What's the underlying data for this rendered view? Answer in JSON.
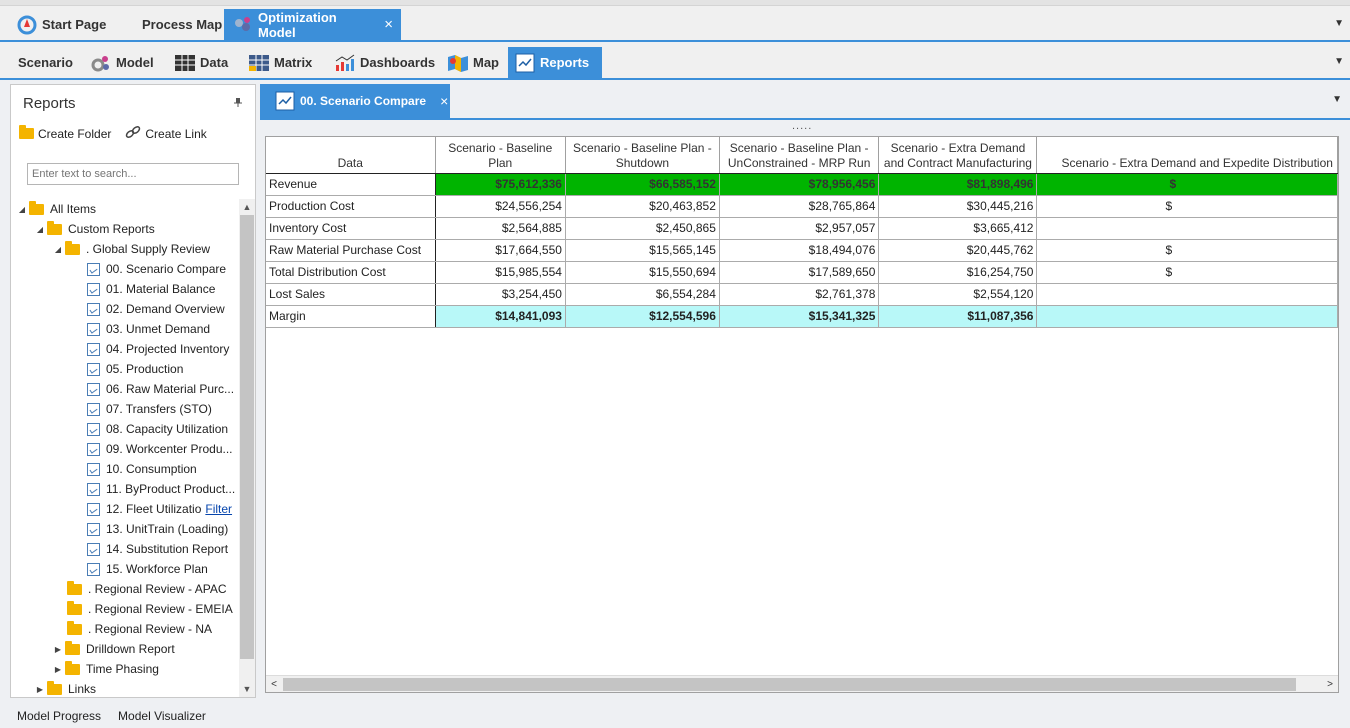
{
  "top_tabs": {
    "items": [
      {
        "label": "Start Page"
      },
      {
        "label": "Process Map"
      },
      {
        "label": "Optimization Model"
      }
    ],
    "close_glyph": "×",
    "menu_glyph": "▼"
  },
  "module_tabs": {
    "items": [
      {
        "label": "Scenario"
      },
      {
        "label": "Model"
      },
      {
        "label": "Data"
      },
      {
        "label": "Matrix"
      },
      {
        "label": "Dashboards"
      },
      {
        "label": "Map"
      },
      {
        "label": "Reports"
      }
    ],
    "active": "Reports",
    "menu_glyph": "▼"
  },
  "reports_panel": {
    "title": "Reports",
    "pin_glyph": "📌",
    "create_folder": "Create Folder",
    "create_link": "Create Link",
    "search_placeholder": "Enter text to search...",
    "tree": {
      "all_items": "All Items",
      "custom_reports": "Custom Reports",
      "global_supply_review": ". Global Supply Review",
      "reports": [
        "00. Scenario Compare",
        "01. Material Balance",
        "02. Demand Overview",
        "03. Unmet Demand",
        "04. Projected Inventory",
        "05. Production",
        "06. Raw Material Purc...",
        "07. Transfers (STO)",
        "08. Capacity Utilization",
        "09. Workcenter Produ...",
        "10. Consumption",
        "11. ByProduct Product...",
        "12. Fleet Utilizatio",
        "13. UnitTrain (Loading)",
        "14. Substitution Report",
        "15. Workforce Plan"
      ],
      "filter_link": "Filter",
      "folders_after": [
        ". Regional Review - APAC",
        ". Regional Review - EMEIA",
        ". Regional Review - NA"
      ],
      "drilldown": "Drilldown Report",
      "time_phasing": "Time Phasing",
      "links": "Links"
    }
  },
  "doc_tab": {
    "label": "00. Scenario Compare",
    "close_glyph": "×",
    "menu_glyph": "▼",
    "splitter_dots": "....."
  },
  "grid": {
    "columns": [
      "Data",
      "Scenario - Baseline Plan",
      "Scenario - Baseline Plan - Shutdown",
      "Scenario - Baseline Plan - UnConstrained - MRP Run",
      "Scenario - Extra Demand and Contract Manufacturing",
      "Scenario - Extra Demand and Expedite Distribution"
    ],
    "rows": [
      {
        "label": "Revenue",
        "values": [
          "$75,612,336",
          "$66,585,152",
          "$78,956,456",
          "$81,898,496",
          "$"
        ],
        "style": "rev"
      },
      {
        "label": "Production Cost",
        "values": [
          "$24,556,254",
          "$20,463,852",
          "$28,765,864",
          "$30,445,216",
          "$"
        ],
        "style": ""
      },
      {
        "label": "Inventory Cost",
        "values": [
          "$2,564,885",
          "$2,450,865",
          "$2,957,057",
          "$3,665,412",
          ""
        ],
        "style": ""
      },
      {
        "label": "Raw Material Purchase Cost",
        "values": [
          "$17,664,550",
          "$15,565,145",
          "$18,494,076",
          "$20,445,762",
          "$"
        ],
        "style": ""
      },
      {
        "label": "Total Distribution Cost",
        "values": [
          "$15,985,554",
          "$15,550,694",
          "$17,589,650",
          "$16,254,750",
          "$"
        ],
        "style": ""
      },
      {
        "label": "Lost Sales",
        "values": [
          "$3,254,450",
          "$6,554,284",
          "$2,761,378",
          "$2,554,120",
          ""
        ],
        "style": ""
      },
      {
        "label": "Margin",
        "values": [
          "$14,841,093",
          "$12,554,596",
          "$15,341,325",
          "$11,087,356",
          ""
        ],
        "style": "mar"
      }
    ]
  },
  "bottom_tabs": [
    "Model Progress",
    "Model Visualizer"
  ],
  "colors": {
    "accent": "#3c8fd9",
    "revenue_bg": "#00b400",
    "margin_bg": "#b8f8f8",
    "folder": "#f4b400"
  }
}
